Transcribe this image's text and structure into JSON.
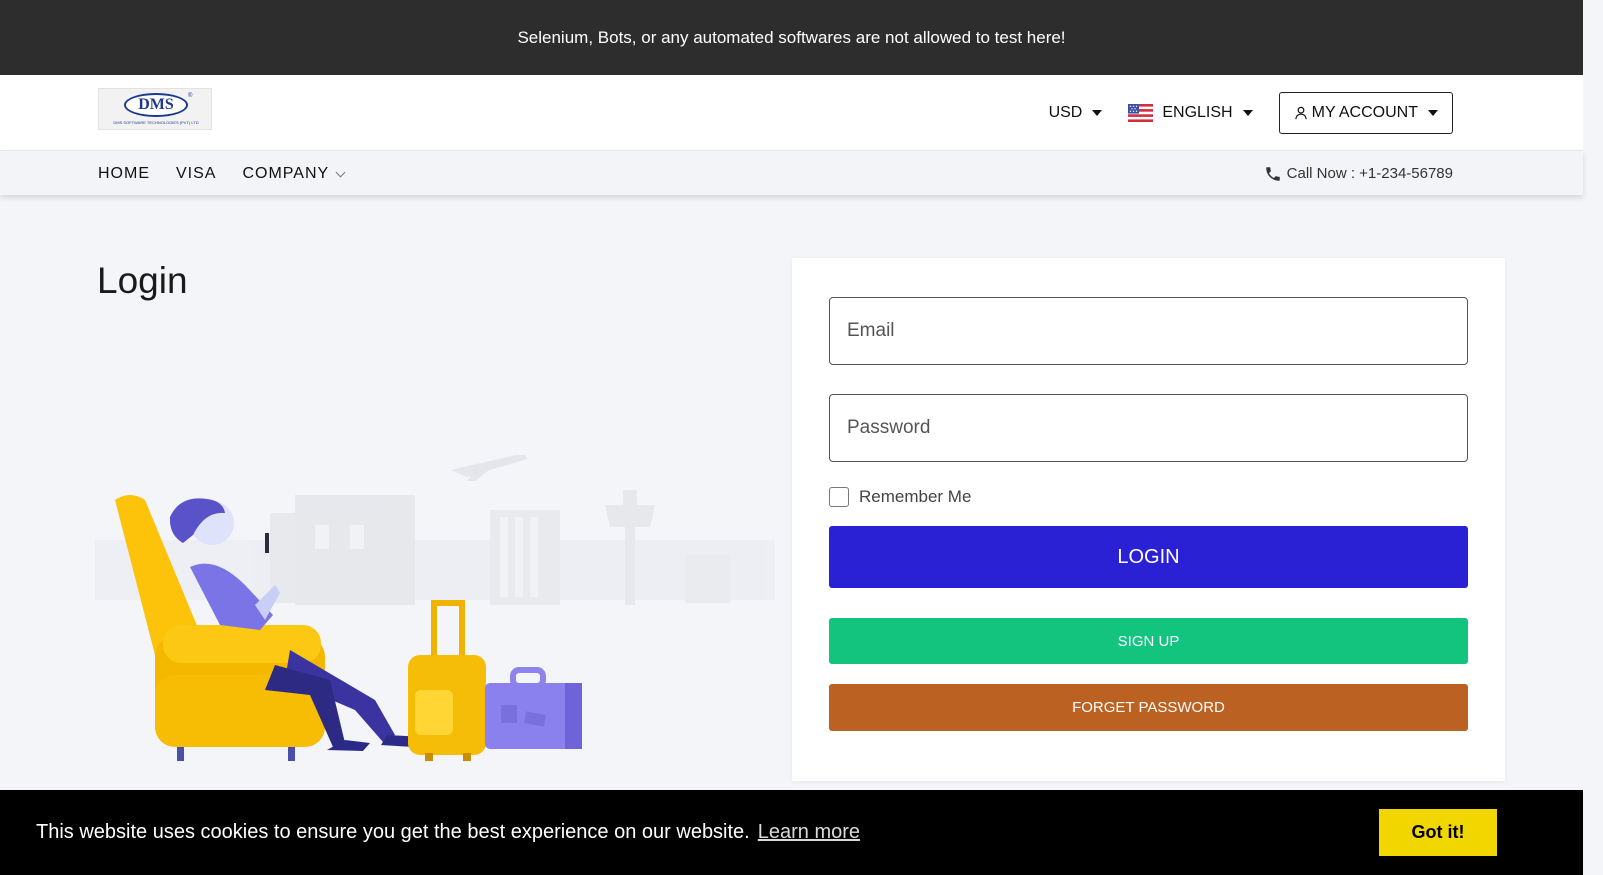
{
  "banner": {
    "text": "Selenium, Bots, or any automated softwares are not allowed to test here!"
  },
  "header": {
    "logo": {
      "name": "DMS",
      "registered": "®",
      "tagline": "DMS SOFTWARE TECHNOLOGIES (PVT) LTD"
    },
    "currency": {
      "selected": "USD"
    },
    "language": {
      "selected": "ENGLISH",
      "flag_icon": "us-flag-icon"
    },
    "account": {
      "label": "MY ACCOUNT",
      "icon": "user-icon"
    }
  },
  "nav": {
    "items": [
      {
        "label": "HOME"
      },
      {
        "label": "VISA"
      },
      {
        "label": "COMPANY"
      }
    ],
    "call": {
      "label": "Call Now : +1-234-56789",
      "icon": "phone-icon"
    }
  },
  "page": {
    "title": "Login"
  },
  "form": {
    "email_placeholder": "Email",
    "email_value": "",
    "password_placeholder": "Password",
    "password_value": "",
    "remember_label": "Remember Me",
    "remember_checked": false,
    "login_label": "LOGIN",
    "signup_label": "SIGN UP",
    "forget_label": "FORGET PASSWORD"
  },
  "cookie": {
    "message": "This website uses cookies to ensure you get the best experience on our website.",
    "link": "Learn more",
    "button": "Got it!"
  },
  "colors": {
    "banner_bg": "#2d2d2d",
    "login": "#2b21d4",
    "signup": "#12c47e",
    "forget": "#bb6122",
    "cookie_button": "#f1d600"
  }
}
